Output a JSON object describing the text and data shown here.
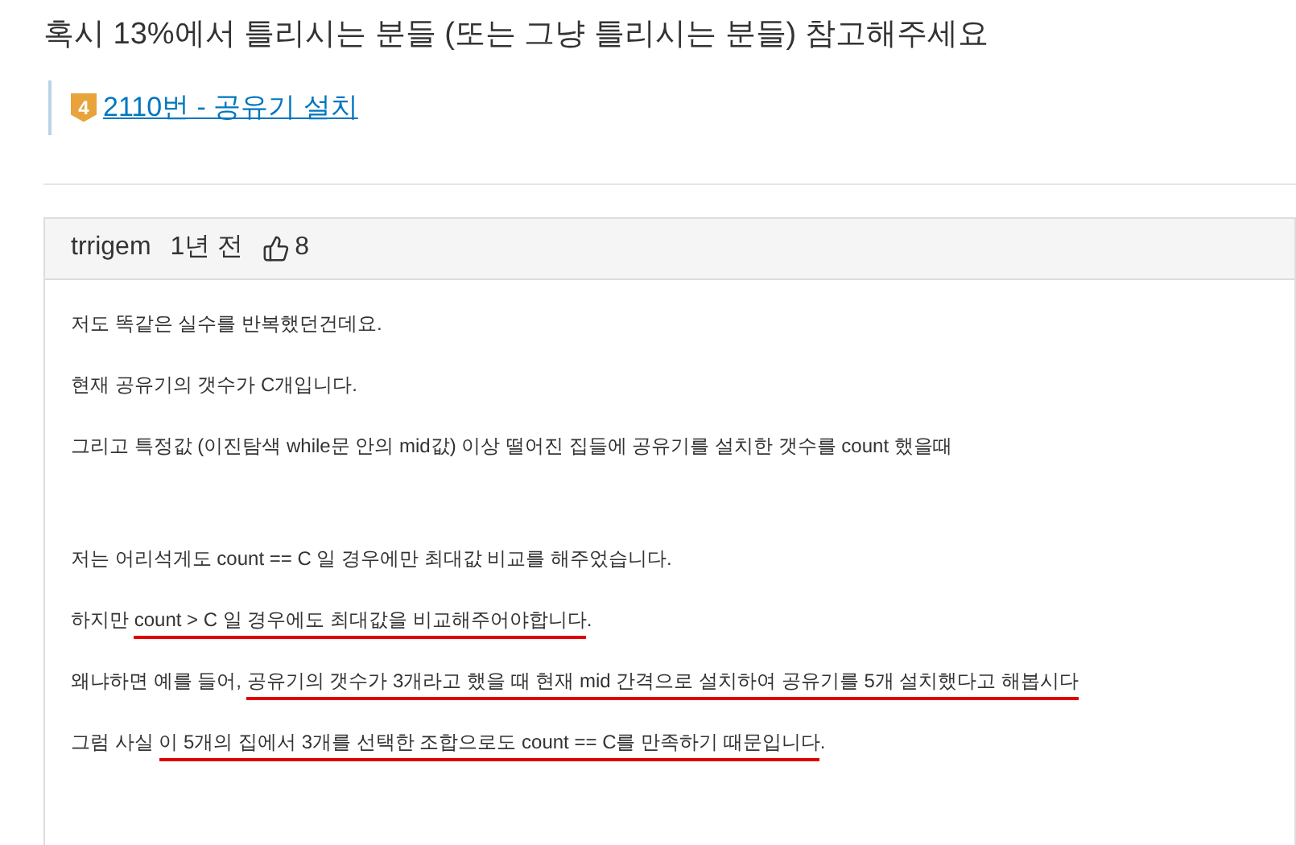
{
  "title": "혹시 13%에서 틀리시는 분들 (또는 그냥 틀리시는 분들) 참고해주세요",
  "problem": {
    "tier": "4",
    "link": "2110번 - 공유기 설치"
  },
  "comment": {
    "author": "trrigem",
    "time": "1년 전",
    "likes": "8",
    "paragraphs": [
      {
        "segments": [
          {
            "text": "저도 똑같은 실수를 반복했던건데요.",
            "underlined": false
          }
        ]
      },
      {
        "segments": [
          {
            "text": "현재 공유기의 갯수가 C개입니다.",
            "underlined": false
          }
        ]
      },
      {
        "segments": [
          {
            "text": "그리고 특정값 (이진탐색 while문 안의 mid값) 이상 떨어진 집들에 공유기를 설치한 갯수를 count 했을때",
            "underlined": false
          }
        ],
        "gap_after": true
      },
      {
        "segments": [
          {
            "text": "저는 어리석게도 count == C 일 경우에만 최대값 비교를 해주었습니다.",
            "underlined": false
          }
        ]
      },
      {
        "segments": [
          {
            "text": "하지만 ",
            "underlined": false
          },
          {
            "text": "count > C 일 경우에도 최대값을 비교해주어야합니다",
            "underlined": true
          },
          {
            "text": ".",
            "underlined": false
          }
        ]
      },
      {
        "segments": [
          {
            "text": "왜냐하면 예를 들어, ",
            "underlined": false
          },
          {
            "text": "공유기의 갯수가 3개라고 했을 때 현재",
            "underlined": true
          },
          {
            "text": " mid 간격으로 설치하여 공유기를 5개 설치했다고 해봅시다",
            "underlined": true
          }
        ]
      },
      {
        "segments": [
          {
            "text": "그럼 사실 ",
            "underlined": false
          },
          {
            "text": "이 5개의 집에서 3개를 선택한 조합으로도 count == C를 만족하기 때문입니다",
            "underlined": true
          },
          {
            "text": ".",
            "underlined": false
          }
        ]
      }
    ]
  }
}
